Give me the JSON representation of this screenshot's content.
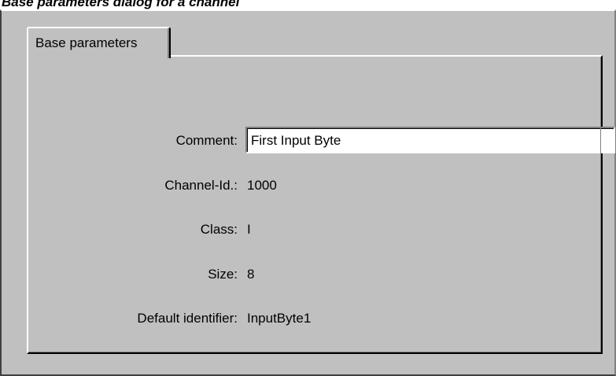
{
  "caption": "Base parameters dialog for a channel",
  "tabs": [
    {
      "label": "Base parameters",
      "active": true
    }
  ],
  "fields": {
    "comment": {
      "label": "Comment:",
      "value": "First Input Byte"
    },
    "channel_id": {
      "label": "Channel-Id.:",
      "value": "1000"
    },
    "class": {
      "label": "Class:",
      "value": "I"
    },
    "size": {
      "label": "Size:",
      "value": "8"
    },
    "default_identifier": {
      "label": "Default identifier:",
      "value": "InputByte1"
    }
  },
  "colors": {
    "dialog_background": "#c0c0c0",
    "input_background": "#ffffff",
    "text": "#000000"
  }
}
